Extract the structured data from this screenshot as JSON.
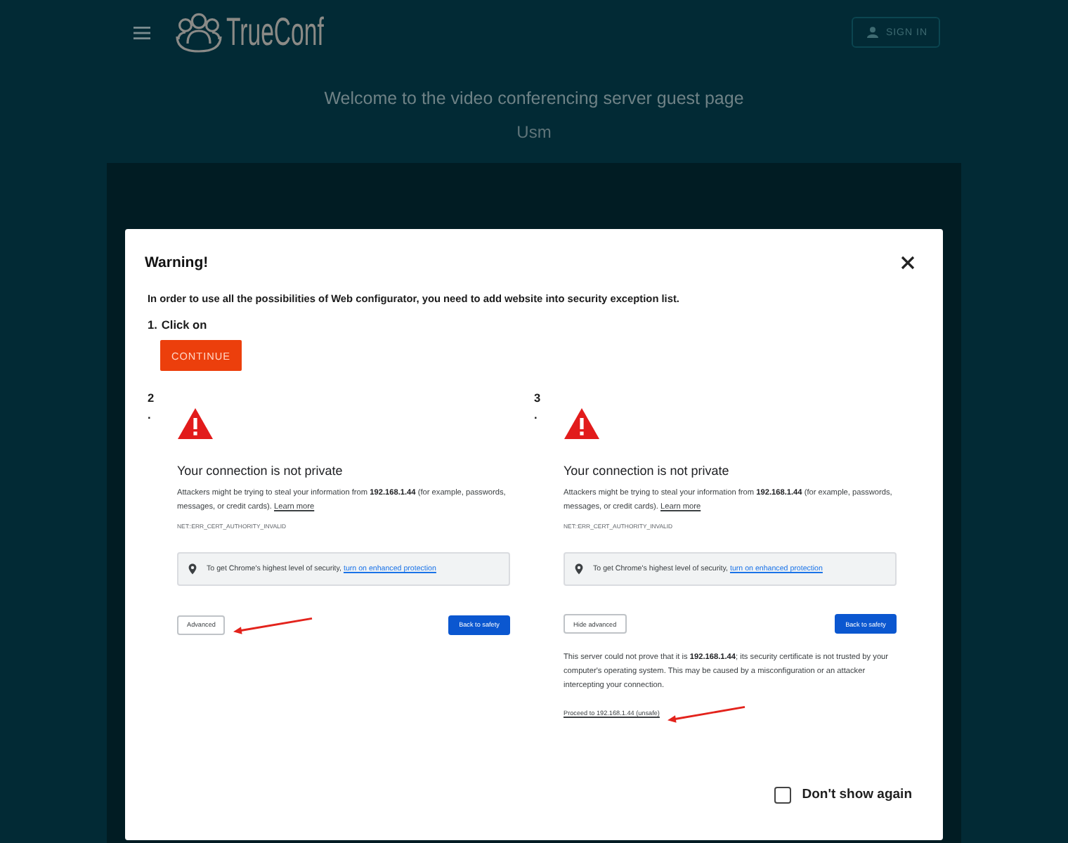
{
  "header": {
    "logo_text": "TrueConf",
    "sign_in_button": "SIGN IN"
  },
  "welcome": {
    "title": "Welcome to the video conferencing server guest page",
    "subtitle": "Usm"
  },
  "dialog": {
    "title": "Warning!",
    "message": "In order to use all the possibilities of Web configurator, you need to add website into security exception list.",
    "steps": [
      {
        "kind": "button",
        "number": "1.",
        "text": "Click on",
        "button": "CONTINUE"
      },
      {
        "kind": "screenshot",
        "number": "2.",
        "screenshot": {
          "title": "Your connection is not private",
          "message": "Attackers might be trying to steal your information from **192.168.1.44** (for example, passwords, messages, or credit cards).",
          "learn_more": "Learn more",
          "error_code": "NET::ERR_CERT_AUTHORITY_INVALID",
          "protection_text": "To get Chrome's highest level of security,",
          "protection_link": "turn on enhanced protection",
          "advanced_button": "Advanced",
          "safety_button": "Back to safety"
        }
      },
      {
        "kind": "screenshot",
        "number": "3.",
        "screenshot": {
          "title": "Your connection is not private",
          "message": "Attackers might be trying to steal your information from **192.168.1.44** (for example, passwords, messages, or credit cards).",
          "learn_more": "Learn more",
          "error_code": "NET::ERR_CERT_AUTHORITY_INVALID",
          "protection_text": "To get Chrome's highest level of security,",
          "protection_link": "turn on enhanced protection",
          "advanced_button": "Hide advanced",
          "safety_button": "Back to safety",
          "details": "This server could not prove that it is **192.168.1.44**; its security certificate is not trusted by your computer's operating system. This may be caused by a misconfiguration or an attacker intercepting your connection.",
          "proceed_link": "Proceed to 192.168.1.44 (unsafe)"
        }
      }
    ],
    "dont_show_again": {
      "label": "Don't show again",
      "checked": false
    }
  }
}
